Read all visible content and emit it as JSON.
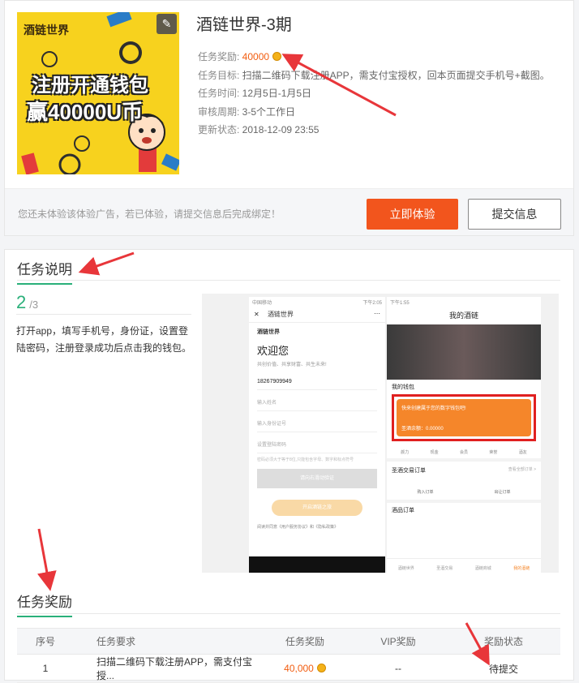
{
  "task": {
    "title": "酒链世界-3期",
    "reward_label": "任务奖励: ",
    "reward_value": "40000",
    "goal_label": "任务目标: ",
    "goal_value": "扫描二维码下载注册APP，需支付宝授权，回本页面提交手机号+截图。",
    "time_label": "任务时间: ",
    "time_value": "12月5日-1月5日",
    "review_label": "审核周期: ",
    "review_value": "3-5个工作日",
    "update_label": "更新状态: ",
    "update_value": "2018-12-09 23:55"
  },
  "banner": {
    "brand": "酒链世界",
    "line1": "注册开通钱包",
    "line2": "赢40000U币"
  },
  "action_bar": {
    "hint": "您还未体验该体验广告，若已体验，请提交信息后完成绑定！",
    "experience_button": "立即体验",
    "submit_button": "提交信息"
  },
  "description": {
    "section_title": "任务说明",
    "step_current": "2",
    "step_total": "/3",
    "step_text": "打开app，填写手机号，身份证，设置登陆密码，注册登录成功后点击我的钱包。"
  },
  "screenshot_left": {
    "status_bar": "中国移动",
    "status_right": "下午2:05",
    "nav_title": "酒链世界",
    "logo_text": "酒链世界",
    "welcome": "欢迎您",
    "welcome_sub": "共创价值、共享财富、共生未来!",
    "phone_number": "18267909949",
    "name_placeholder": "输入姓名",
    "id_placeholder": "输入身份证号",
    "password_placeholder": "设置登陆密码",
    "password_hint": "密码必须大于等于8位,只能包含字母、数字和标点符号",
    "slider_text": "请向右滑动验证",
    "start_button": "开启酒链之旅",
    "agree_text": "阅读并同意《用户服务协议》和《隐私政策》"
  },
  "screenshot_right": {
    "status_bar": "下午1:55",
    "page_title": "我的酒链",
    "wallet_section": "我的钱包",
    "wallet_prompt": "快来创建属于您的数字钱包吧!",
    "wallet_balance": "圣酒余额：0.00000",
    "icons": [
      "颜力",
      "现金",
      "会员",
      "荣誉",
      "酒友"
    ],
    "orders_title": "圣酒交易订单",
    "orders_all": "查看全部订单 >",
    "order_buy": "购入订单",
    "order_sell": "出让订单",
    "orders2_title": "酒品订单",
    "tabs": [
      "酒链世界",
      "圣酒交易",
      "酒链商城",
      "我的酒链"
    ]
  },
  "reward": {
    "section_title": "任务奖励",
    "headers": [
      "序号",
      "任务要求",
      "任务奖励",
      "VIP奖励",
      "奖励状态"
    ],
    "rows": [
      {
        "no": "1",
        "requirement": "扫描二维码下载注册APP，需支付宝授...",
        "reward": "40,000",
        "vip": "--",
        "status": "待提交"
      }
    ]
  },
  "colors": {
    "accent_orange": "#f2551d",
    "accent_green": "#2ab07a",
    "annotation_red": "#e8363a"
  }
}
